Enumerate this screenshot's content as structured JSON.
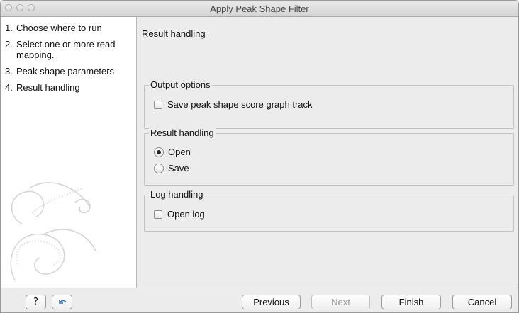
{
  "window": {
    "title": "Apply Peak Shape Filter"
  },
  "sidebar": {
    "steps": [
      {
        "num": "1.",
        "label": "Choose where to run"
      },
      {
        "num": "2.",
        "label": "Select one or more read mapping."
      },
      {
        "num": "3.",
        "label": "Peak shape parameters"
      },
      {
        "num": "4.",
        "label": "Result handling"
      }
    ]
  },
  "main": {
    "title": "Result handling",
    "output_options": {
      "legend": "Output options",
      "save_graph_label": "Save peak shape score graph track",
      "save_graph_checked": false
    },
    "result_handling": {
      "legend": "Result handling",
      "open_label": "Open",
      "save_label": "Save",
      "selected": "Open"
    },
    "log_handling": {
      "legend": "Log handling",
      "open_log_label": "Open log",
      "open_log_checked": false
    }
  },
  "buttons": {
    "help": "?",
    "previous": "Previous",
    "next": "Next",
    "finish": "Finish",
    "cancel": "Cancel"
  }
}
